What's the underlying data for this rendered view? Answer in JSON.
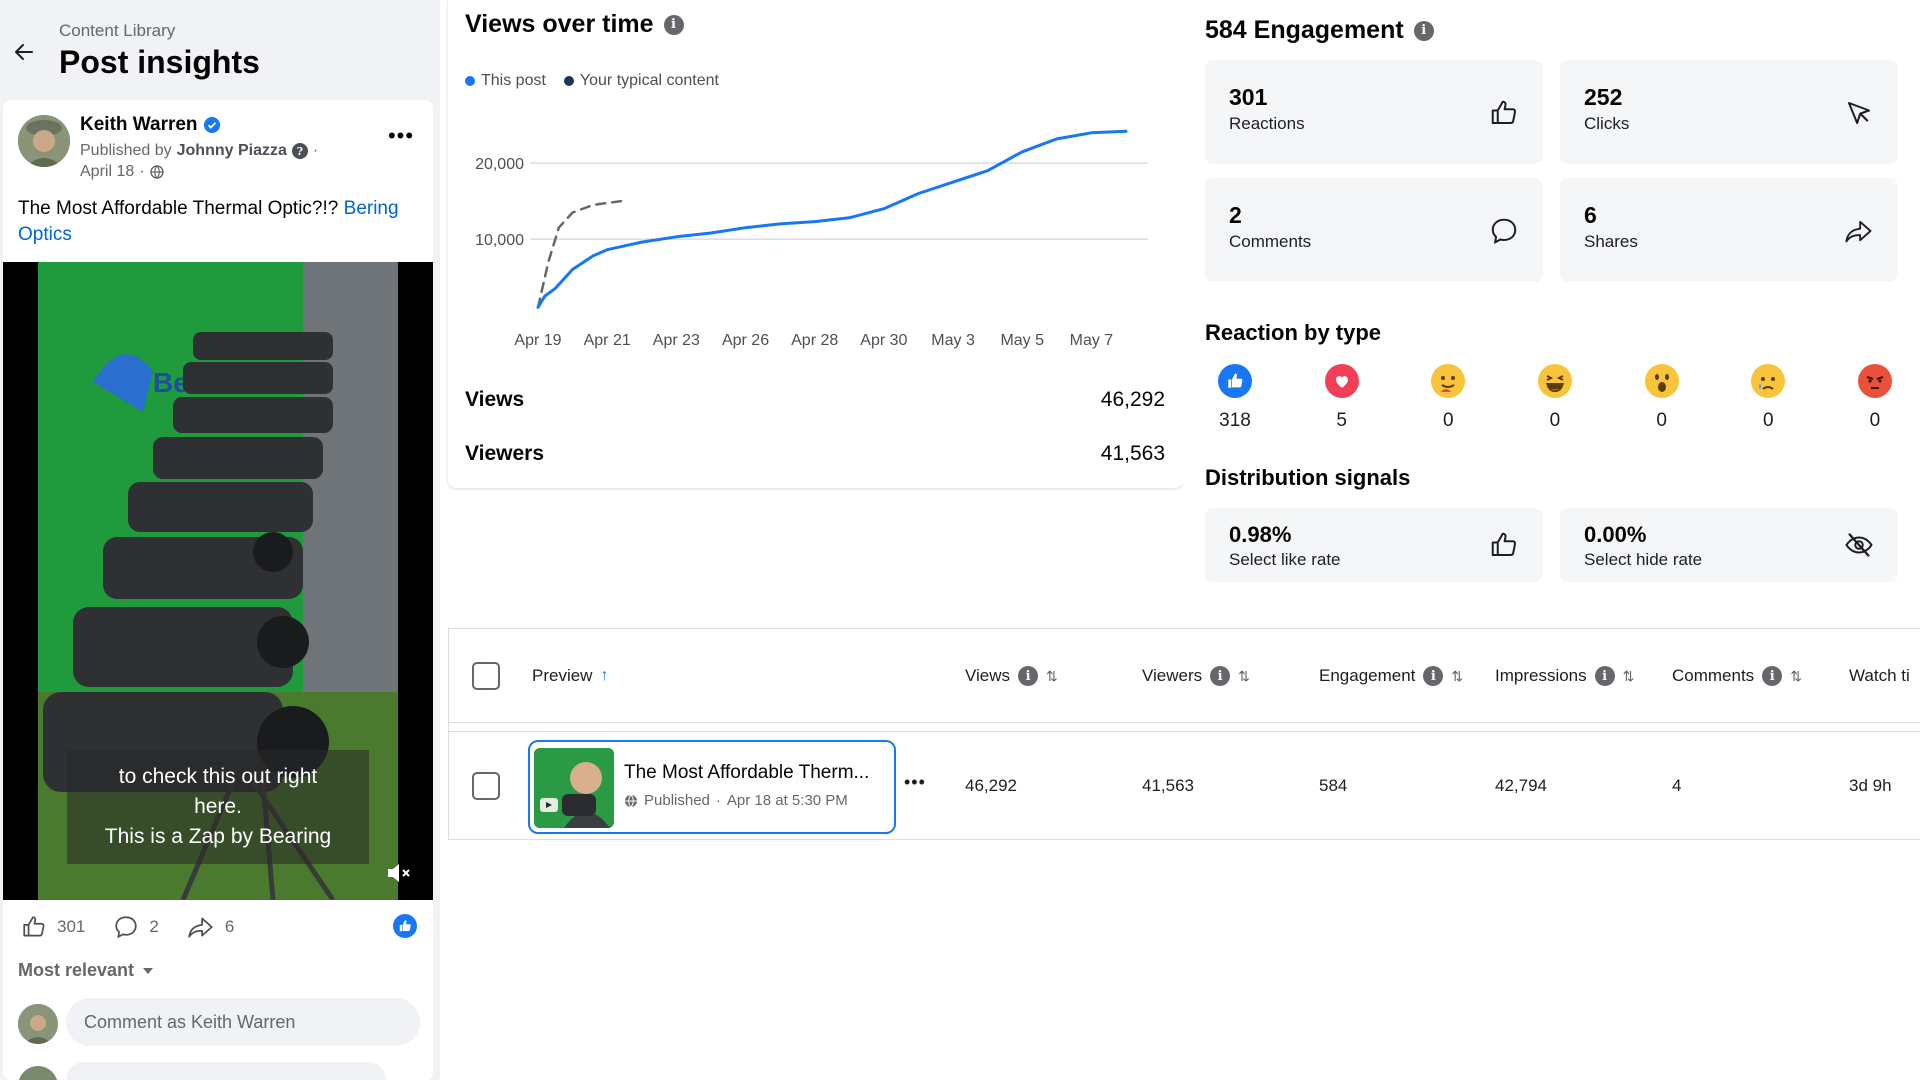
{
  "header": {
    "breadcrumb": "Content Library",
    "title": "Post insights"
  },
  "post": {
    "author": "Keith Warren",
    "published_prefix": "Published by",
    "publisher": "Johnny Piazza",
    "date": "April 18",
    "caption_text": "The Most Affordable Thermal Optic?!? ",
    "caption_link": "Bering Optics",
    "video_subtitle": [
      "to check this out right",
      "here.",
      "This is a Zap by Bearing"
    ],
    "reactions": "301",
    "comments": "2",
    "shares": "6",
    "sort_label": "Most relevant",
    "comment_placeholder": "Comment as Keith Warren"
  },
  "views_chart": {
    "title": "Views over time",
    "legend": [
      "This post",
      "Your typical content"
    ],
    "metrics": [
      {
        "label": "Views",
        "value": "46,292"
      },
      {
        "label": "Viewers",
        "value": "41,563"
      }
    ]
  },
  "chart_data": {
    "type": "line",
    "title": "Views over time",
    "categories": [
      "Apr 19",
      "Apr 21",
      "Apr 23",
      "Apr 26",
      "Apr 28",
      "Apr 30",
      "May 3",
      "May 5",
      "May 7"
    ],
    "ylim": [
      0,
      27000
    ],
    "yticks": [
      "10,000",
      "20,000"
    ],
    "ytick_values": [
      10000,
      20000
    ],
    "grid": true,
    "legend_position": "top-left",
    "series": [
      {
        "name": "This post",
        "color": "#1877f2",
        "dash": false,
        "x": [
          0,
          0.1,
          0.25,
          0.5,
          0.8,
          1,
          1.5,
          2,
          2.5,
          3,
          3.5,
          4,
          4.5,
          5,
          5.5,
          6,
          6.5,
          7,
          7.5,
          8,
          8.5
        ],
        "y": [
          1000,
          2500,
          3500,
          6000,
          7800,
          8600,
          9600,
          10300,
          10800,
          11500,
          12000,
          12300,
          12800,
          14000,
          16000,
          17500,
          19000,
          21500,
          23200,
          24000,
          24200
        ]
      },
      {
        "name": "Your typical content",
        "color": "#65676b",
        "dash": true,
        "x": [
          0,
          0.15,
          0.3,
          0.5,
          0.8,
          1.2
        ],
        "y": [
          1000,
          7000,
          11500,
          13500,
          14500,
          15000
        ]
      }
    ]
  },
  "engagement": {
    "title": "584 Engagement",
    "cards": [
      {
        "value": "301",
        "label": "Reactions",
        "icon": "thumbs-up-icon"
      },
      {
        "value": "252",
        "label": "Clicks",
        "icon": "cursor-icon"
      },
      {
        "value": "2",
        "label": "Comments",
        "icon": "comment-icon"
      },
      {
        "value": "6",
        "label": "Shares",
        "icon": "share-icon"
      }
    ],
    "reaction_title": "Reaction by type",
    "reaction_counts": [
      "318",
      "5",
      "0",
      "0",
      "0",
      "0",
      "0"
    ],
    "reaction_icons": [
      "like-reaction-icon",
      "love-reaction-icon",
      "care-reaction-icon",
      "haha-reaction-icon",
      "wow-reaction-icon",
      "sad-reaction-icon",
      "angry-reaction-icon"
    ],
    "distribution_title": "Distribution signals",
    "distribution": [
      {
        "value": "0.98%",
        "label": "Select like rate",
        "icon": "thumbs-up-icon"
      },
      {
        "value": "0.00%",
        "label": "Select hide rate",
        "icon": "hidden-eye-icon"
      }
    ]
  },
  "table": {
    "columns": [
      "Preview",
      "Views",
      "Viewers",
      "Engagement",
      "Impressions",
      "Comments",
      "Watch ti"
    ],
    "row": {
      "title": "The Most Affordable Therm...",
      "status": "Published",
      "date": "Apr 18 at 5:30 PM",
      "views": "46,292",
      "viewers": "41,563",
      "engagement": "584",
      "impressions": "42,794",
      "comments": "4",
      "watch_time": "3d 9h"
    }
  },
  "colors": {
    "accent": "#1877f2",
    "text": "#050505",
    "muted": "#65676b",
    "card": "#f5f6f7"
  }
}
